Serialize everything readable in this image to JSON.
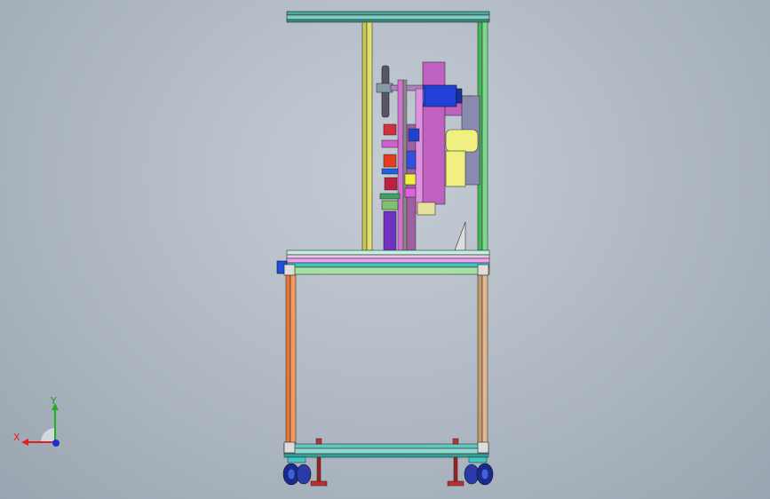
{
  "triad": {
    "x_label": "X",
    "y_label": "Y"
  },
  "colors": {
    "background_center": "#c4cbd4",
    "background_edge": "#9aa5b1",
    "axis_x": "#e02020",
    "axis_y": "#20b020",
    "axis_z": "#2030d0",
    "frame_teal": "#3fb0a8",
    "frame_orange": "#e8743a",
    "frame_tan": "#c89a6a",
    "frame_yellow": "#c8c850",
    "frame_green": "#40b858",
    "magenta": "#c060c0",
    "motor_blue": "#2040d8",
    "light_yellow": "#f0f080"
  }
}
